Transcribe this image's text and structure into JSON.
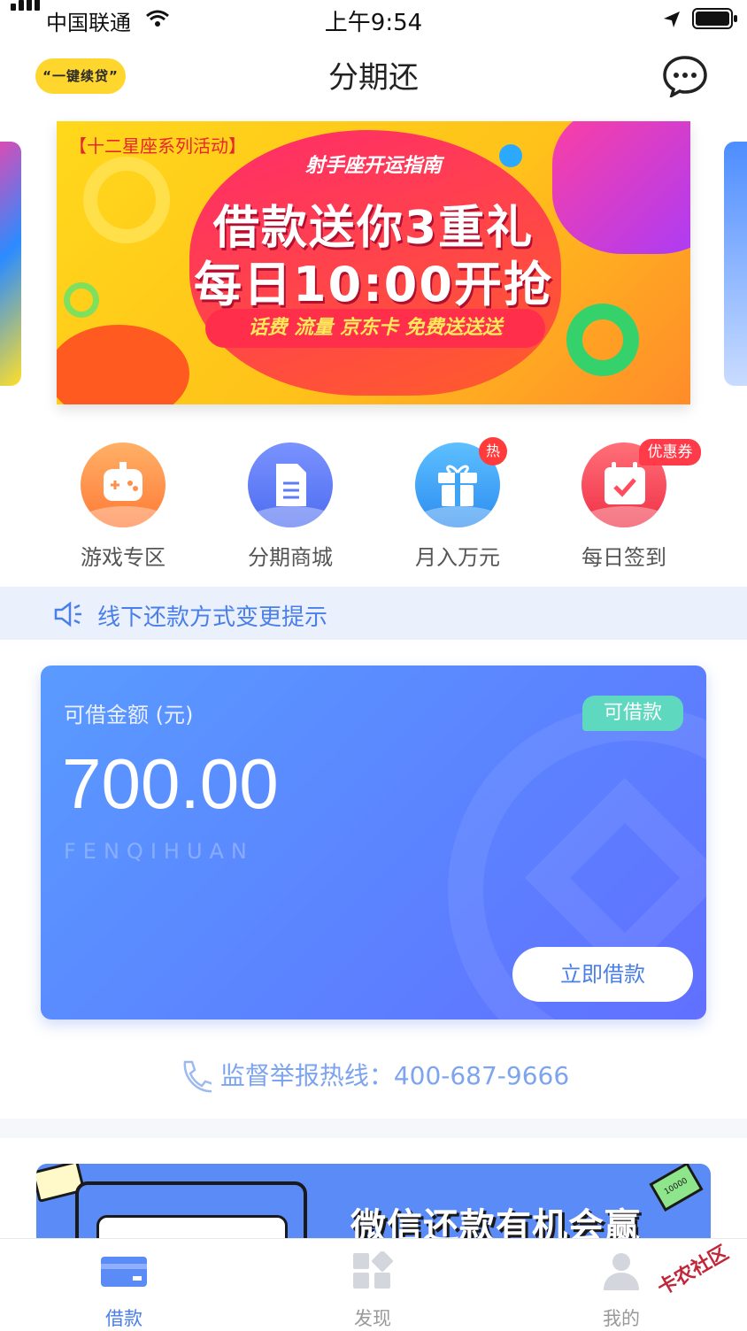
{
  "status_bar": {
    "carrier": "中国联通",
    "time": "上午9:54"
  },
  "header": {
    "logo_text": "“一键续贷”",
    "title": "分期还"
  },
  "banner": {
    "tag": "【十二星座系列活动】",
    "subtitle": "射手座开运指南",
    "line1": "借款送你3重礼",
    "line2": "每日10:00开抢",
    "pill": "话费 流量 京东卡 免费送送送"
  },
  "quick_nav": [
    {
      "label": "游戏专区",
      "icon": "gamepad-icon",
      "color": "#ff8f4a"
    },
    {
      "label": "分期商城",
      "icon": "document-icon",
      "color": "#5b7cf5"
    },
    {
      "label": "月入万元",
      "icon": "gift-icon",
      "color": "#3ea4f5",
      "badge": "热"
    },
    {
      "label": "每日签到",
      "icon": "calendar-check-icon",
      "color": "#ff4d5e",
      "badge": "优惠券"
    }
  ],
  "notice": {
    "text": "线下还款方式变更提示"
  },
  "loan_card": {
    "label": "可借金额 (元)",
    "amount": "700.00",
    "watermark": "FENQIHUAN",
    "badge": "可借款",
    "button": "立即借款"
  },
  "hotline": {
    "text": "监督举报热线：400-687-9666"
  },
  "bottom_banner": {
    "text": "微信还款有机会赢",
    "bill_text": "10000"
  },
  "tab_bar": [
    {
      "label": "借款",
      "active": true
    },
    {
      "label": "发现",
      "active": false
    },
    {
      "label": "我的",
      "active": false
    }
  ],
  "watermark": "卡农社区",
  "colors": {
    "primary": "#4a7ee8",
    "card_start": "#5a9bff",
    "card_end": "#6170ff",
    "badge_green": "#5fd8c0"
  }
}
